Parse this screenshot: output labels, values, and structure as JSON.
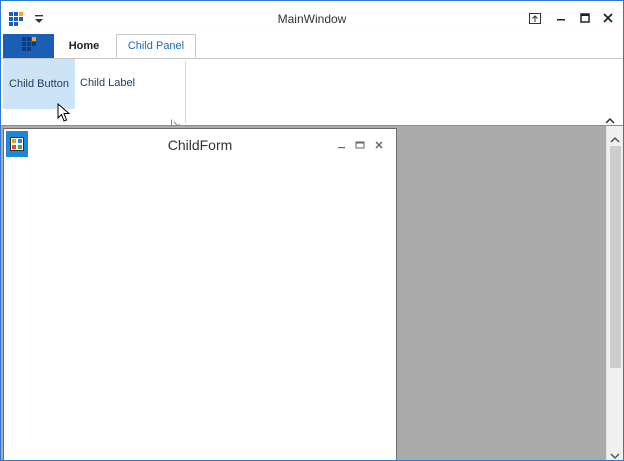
{
  "window": {
    "title": "MainWindow"
  },
  "ribbon": {
    "tabs": [
      {
        "label": "Home"
      },
      {
        "label": "Child Panel"
      }
    ],
    "items": {
      "child_button": "Child Button",
      "child_label": "Child Label"
    }
  },
  "child_form": {
    "title": "ChildForm"
  },
  "icons": {
    "app": "app-grid-icon",
    "qat": "quick-access-dropdown-icon",
    "file": "file-menu-icon",
    "restore_ribbon": "ribbon-display-options-icon",
    "minimize": "minimize-icon",
    "maximize": "maximize-icon",
    "close": "close-icon",
    "launcher": "dialog-launcher-icon",
    "collapse": "collapse-ribbon-icon"
  },
  "colors": {
    "accent": "#1a5fb4",
    "tab_active_text": "#1a66c2",
    "hover": "#cde4f7",
    "mdi_background": "#ababab"
  }
}
